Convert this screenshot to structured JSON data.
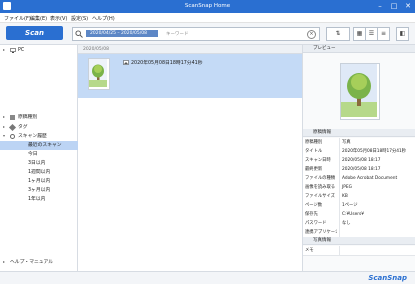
{
  "window": {
    "title": "ScanSnap Home",
    "minimize": "–",
    "maximize": "□",
    "close": "✕"
  },
  "menu": [
    "ファイル(F)",
    "編集(E)",
    "表示(V)",
    "設定(S)",
    "ヘルプ(H)"
  ],
  "toolbar": {
    "scan_label": "Scan",
    "date_chip": "2020/04/25 – 2020/05/08",
    "keyword_placeholder": "キーワード",
    "clear": "×"
  },
  "sidebar": {
    "pc_label": "PC",
    "items": [
      {
        "label": "原稿種別",
        "icon": "doc-type-icon"
      },
      {
        "label": "タグ",
        "icon": "tag-icon"
      },
      {
        "label": "スキャン履歴",
        "icon": "clock-icon"
      }
    ],
    "history": [
      "最近のスキャン",
      "今日",
      "3日以内",
      "1週間以内",
      "1ヶ月以内",
      "3ヶ月以内",
      "1年以内"
    ],
    "help_label": "ヘルプ・マニュアル"
  },
  "list": {
    "header": "2020/05/08",
    "file_title": "2020年05月08日18時17分41秒"
  },
  "detail": {
    "preview_label": "プレビュー",
    "section_info": "原稿情報",
    "section_photo": "写真情報",
    "properties": [
      {
        "k": "原稿種別",
        "v": "写真"
      },
      {
        "k": "タイトル",
        "v": "2020年05月08日18時17分41秒"
      },
      {
        "k": "スキャン日時",
        "v": "2020/05/08 18:17"
      },
      {
        "k": "最終更新",
        "v": "2020/05/08 18:17"
      },
      {
        "k": "ファイルの種類",
        "v": "Adobe Acrobat Document"
      },
      {
        "k": "画像を読み取る",
        "v": "JPEG"
      },
      {
        "k": "ファイルサイズ",
        "v": "KB"
      },
      {
        "k": "ページ数",
        "v": "1ページ"
      },
      {
        "k": "保存先",
        "v": "C:¥Users¥"
      },
      {
        "k": "パスワード",
        "v": "なし"
      },
      {
        "k": "連携アプリケーション",
        "v": ""
      }
    ],
    "photo_props": [
      {
        "k": "メモ",
        "v": ""
      }
    ]
  },
  "status": {
    "logo": "ScanSnap"
  }
}
